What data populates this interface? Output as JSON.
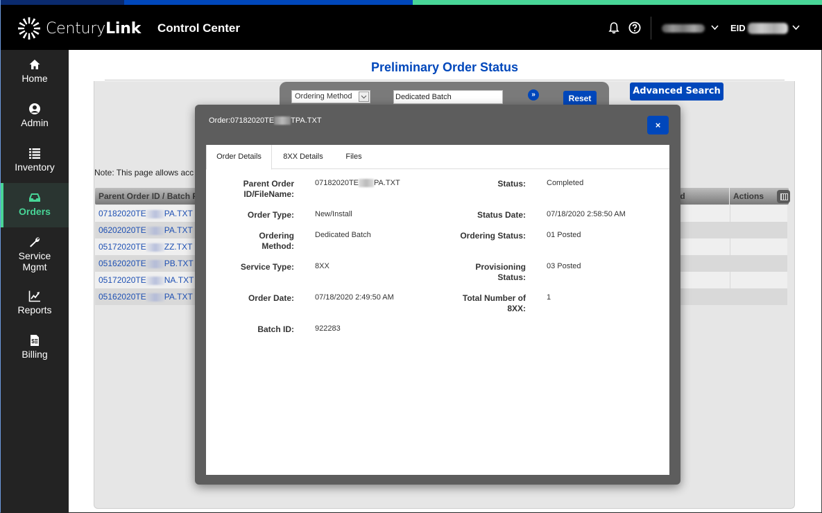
{
  "header": {
    "brand_light": "Century",
    "brand_bold": "Link",
    "app_title": "Control Center",
    "eid_label": "EID",
    "colors": {
      "accent_blue": "#0047bb",
      "accent_green": "#48d597",
      "header_bg": "#000000"
    }
  },
  "sidebar": {
    "items": [
      {
        "label": "Home",
        "icon": "home-icon"
      },
      {
        "label": "Admin",
        "icon": "user-circle-icon"
      },
      {
        "label": "Inventory",
        "icon": "list-icon"
      },
      {
        "label": "Orders",
        "icon": "inbox-icon",
        "active": true
      },
      {
        "label_line1": "Service",
        "label_line2": "Mgmt",
        "icon": "wrench-icon"
      },
      {
        "label": "Reports",
        "icon": "chart-line-icon"
      },
      {
        "label": "Billing",
        "icon": "invoice-icon"
      }
    ]
  },
  "page": {
    "title": "Preliminary Order Status",
    "search": {
      "field_select": "Ordering Method",
      "value": "Dedicated Batch",
      "go_label": "»",
      "reset_label": "Reset"
    },
    "advanced_search_label": "Advanced Search",
    "note": "Note: This page allows acc"
  },
  "table": {
    "columns": [
      "Parent Order ID / Batch F",
      "od",
      "Actions"
    ],
    "rows": [
      {
        "prefix": "07182020TE",
        "suffix": "PA.TXT"
      },
      {
        "prefix": "06202020TE",
        "suffix": "PA.TXT"
      },
      {
        "prefix": "05172020TE",
        "suffix": "ZZ.TXT"
      },
      {
        "prefix": "05162020TE",
        "suffix": "PB.TXT"
      },
      {
        "prefix": "05172020TE",
        "suffix": "NA.TXT"
      },
      {
        "prefix": "05162020TE",
        "suffix": "PA.TXT"
      }
    ]
  },
  "modal": {
    "title_prefix": "Order:07182020TE",
    "title_suffix": "TPA.TXT",
    "close_label": "×",
    "tabs": [
      "Order Details",
      "8XX Details",
      "Files"
    ],
    "left": [
      {
        "label_l1": "Parent Order",
        "label_l2": "ID/FileName:",
        "value_prefix": "07182020TE",
        "value_suffix": "PA.TXT"
      },
      {
        "label_l1": "Order Type:",
        "value": "New/Install"
      },
      {
        "label_l1": "Ordering",
        "label_l2": "Method:",
        "value": "Dedicated Batch"
      },
      {
        "label_l1": "Service Type:",
        "value": "8XX"
      },
      {
        "label_l1": "Order Date:",
        "value": "07/18/2020 2:49:50 AM"
      },
      {
        "label_l1": "Batch ID:",
        "value": "922283"
      }
    ],
    "right": [
      {
        "label_l1": "Status:",
        "value": "Completed"
      },
      {
        "label_l1": "Status Date:",
        "value": "07/18/2020 2:58:50 AM"
      },
      {
        "label_l1": "Ordering Status:",
        "value": "01 Posted"
      },
      {
        "label_l1": "Provisioning",
        "label_l2": "Status:",
        "value": "03 Posted"
      },
      {
        "label_l1": "Total Number of",
        "label_l2": "8XX:",
        "value": "1"
      }
    ]
  }
}
